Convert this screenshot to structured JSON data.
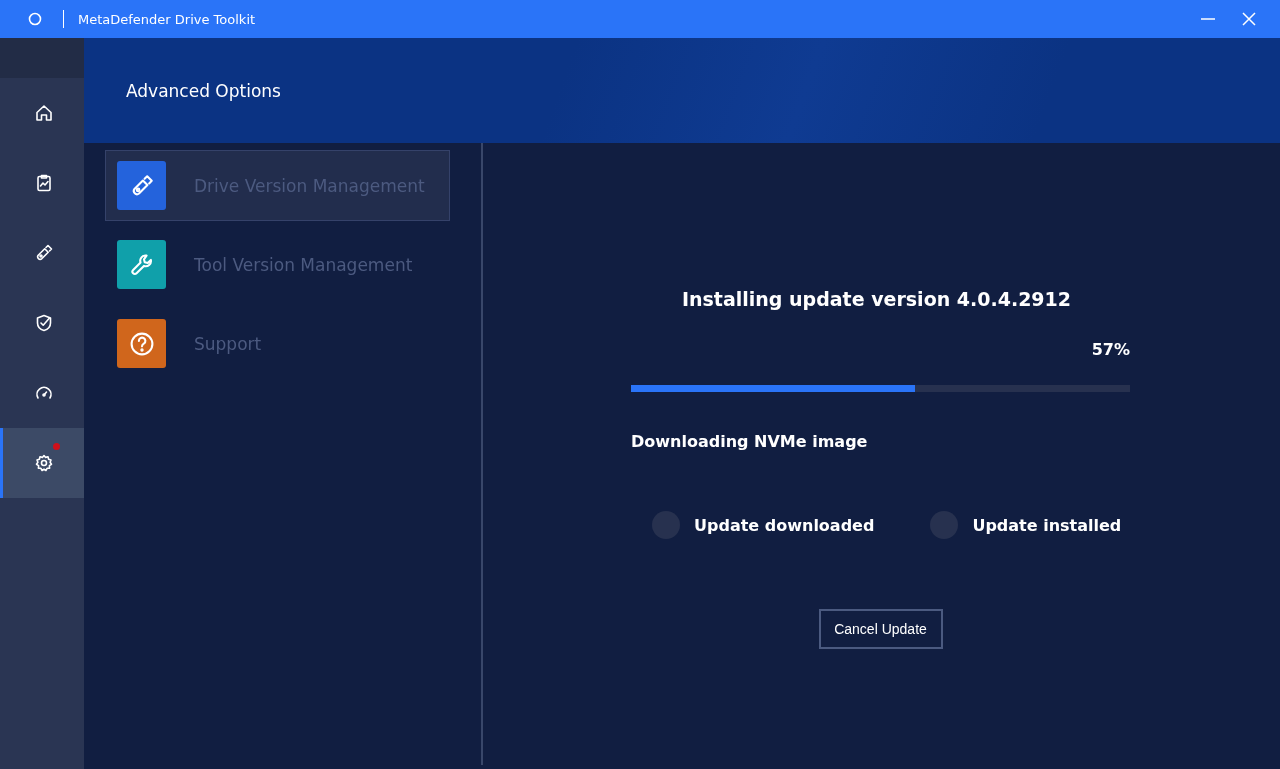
{
  "window": {
    "title": "MetaDefender Drive Toolkit"
  },
  "nav": [
    {
      "kind": "home",
      "selected": false,
      "alert": false
    },
    {
      "kind": "report",
      "selected": false,
      "alert": false
    },
    {
      "kind": "drive",
      "selected": false,
      "alert": false
    },
    {
      "kind": "shield",
      "selected": false,
      "alert": false
    },
    {
      "kind": "gauge",
      "selected": false,
      "alert": false
    },
    {
      "kind": "settings",
      "selected": true,
      "alert": true
    }
  ],
  "header": {
    "title": "Advanced Options"
  },
  "menu": [
    {
      "kind": "drive",
      "label": "Drive Version Management",
      "color": "#2463dc",
      "selected": true
    },
    {
      "kind": "wrench",
      "label": "Tool Version Management",
      "color": "#10a0aa",
      "selected": false
    },
    {
      "kind": "help",
      "label": "Support",
      "color": "#d0661c",
      "selected": false
    }
  ],
  "update": {
    "title": "Installing update version 4.0.4.2912",
    "percent": "57%",
    "level": 0.57,
    "status": "Downloading NVMe image",
    "steps": [
      {
        "label": "Update downloaded",
        "done": false
      },
      {
        "label": "Update installed",
        "done": false
      }
    ],
    "cancel": "Cancel Update"
  }
}
